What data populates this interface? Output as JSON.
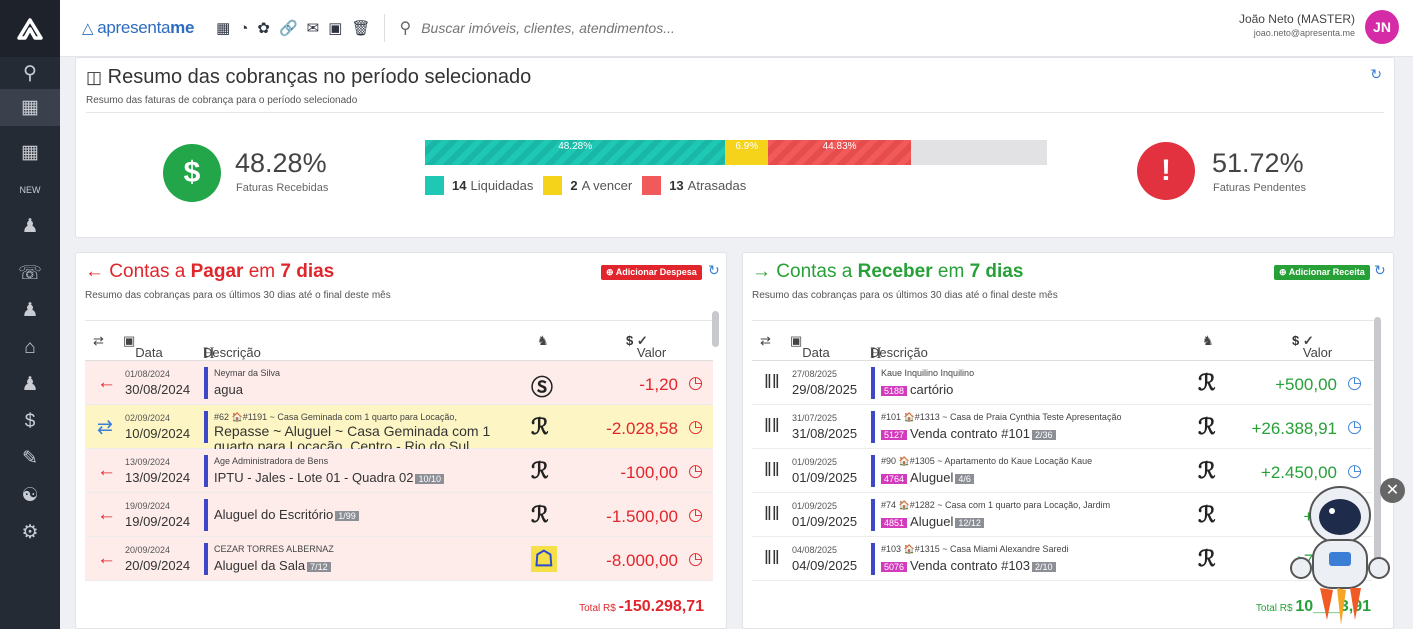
{
  "brand": {
    "prefix": "apresenta",
    "suffix": "me"
  },
  "search": {
    "placeholder": "Buscar imóveis, clientes, atendimentos..."
  },
  "user": {
    "name": "João Neto (MASTER)",
    "email": "joao.neto@apresenta.me",
    "initials": "JN"
  },
  "summary": {
    "title": "Resumo das cobranças no período selecionado",
    "subtitle": "Resumo das faturas de cobrança para o período selecionado",
    "received_pct": "48.28%",
    "received_label": "Faturas Recebidas",
    "pending_pct": "51.72%",
    "pending_label": "Faturas Pendentes",
    "bar": [
      {
        "label": "48.28%",
        "fraction": 0.4828,
        "color": "#1ec8b5"
      },
      {
        "label": "6.9%",
        "fraction": 0.069,
        "color": "#f5d31a"
      },
      {
        "label": "44.83%",
        "fraction": 0.2295,
        "color": "#f05a5a"
      }
    ],
    "legend": [
      {
        "count": "14",
        "label": "Liquidadas",
        "color": "#1ec8b5"
      },
      {
        "count": "2",
        "label": "A vencer",
        "color": "#f5d31a"
      },
      {
        "count": "13",
        "label": "Atrasadas",
        "color": "#f05a5a"
      }
    ]
  },
  "pay": {
    "title_a": "Contas a ",
    "title_b": "Pagar",
    "title_c": " em ",
    "title_d": "7 dias",
    "subtitle": "Resumo das cobranças para os últimos 30 dias até o final deste mês",
    "add_label": "Adicionar Despesa",
    "headers": {
      "date": "Data",
      "desc": "Descrição",
      "value": "Valor"
    },
    "total_label": "Total R$ ",
    "total_value": "-150.298,71",
    "rows": [
      {
        "d1": "01/08/2024",
        "d2": "30/08/2024",
        "meta": "Neymar da Silva",
        "desc": "agua",
        "tag": "",
        "value": "-1,20",
        "bg": "#fdecea"
      },
      {
        "d1": "02/09/2024",
        "d2": "10/09/2024",
        "meta": "#62 🏠#1191 ~ Casa Geminada com 1 quarto para Locação,",
        "desc": "Repasse ~ Aluguel ~ Casa Geminada com 1 quarto para Locação, Centro - Rio do Sul",
        "tag": "",
        "value": "-2.028,58",
        "bg": "#fdf6c4"
      },
      {
        "d1": "13/09/2024",
        "d2": "13/09/2024",
        "meta": "Age Administradora de Bens",
        "desc": "IPTU - Jales - Lote 01 - Quadra 02",
        "tag": "10/10",
        "value": "-100,00",
        "bg": "#fdecea"
      },
      {
        "d1": "19/09/2024",
        "d2": "19/09/2024",
        "meta": "",
        "desc": "Aluguel do Escritório",
        "tag": "1/99",
        "value": "-1.500,00",
        "bg": "#fdecea"
      },
      {
        "d1": "20/09/2024",
        "d2": "20/09/2024",
        "meta": "CEZAR TORRES ALBERNAZ",
        "desc": "Aluguel da Sala",
        "tag": "7/12",
        "value": "-8.000,00",
        "bg": "#fdecea"
      }
    ]
  },
  "recv": {
    "title_a": "Contas a ",
    "title_b": "Receber",
    "title_c": " em ",
    "title_d": "7 dias",
    "subtitle": "Resumo das cobranças para os últimos 30 dias até o final deste mês",
    "add_label": "Adicionar Receita",
    "headers": {
      "date": "Data",
      "desc": "Descrição",
      "value": "Valor"
    },
    "total_label": "Total R$ ",
    "total_value": "10___3,91",
    "rows": [
      {
        "d1": "27/08/2025",
        "d2": "29/08/2025",
        "meta": "Kaue Inquilino  Inquilino",
        "code": "5188",
        "desc": "cartório",
        "tag": "",
        "value": "+500,00"
      },
      {
        "d1": "31/07/2025",
        "d2": "31/08/2025",
        "meta": "#101 🏠#1313 ~ Casa de Praia Cynthia Teste Apresentação",
        "code": "5127",
        "desc": "Venda contrato #101",
        "tag": "2/36",
        "value": "+26.388,91"
      },
      {
        "d1": "01/09/2025",
        "d2": "01/09/2025",
        "meta": "#90 🏠#1305 ~ Apartamento do Kaue Locação  Kaue",
        "code": "4764",
        "desc": "Aluguel",
        "tag": "4/6",
        "value": "+2.450,00"
      },
      {
        "d1": "01/09/2025",
        "d2": "01/09/2025",
        "meta": "#74 🏠#1282 ~ Casa com 1 quarto para Locação, Jardim",
        "code": "4851",
        "desc": "Aluguel",
        "tag": "12/12",
        "value": "+2.9"
      },
      {
        "d1": "04/08/2025",
        "d2": "04/09/2025",
        "meta": "#103 🏠#1315 ~ Casa Miami  Alexandre Saredi",
        "code": "5076",
        "desc": "Venda contrato #103",
        "tag": "2/10",
        "value": "+71.1"
      }
    ]
  }
}
